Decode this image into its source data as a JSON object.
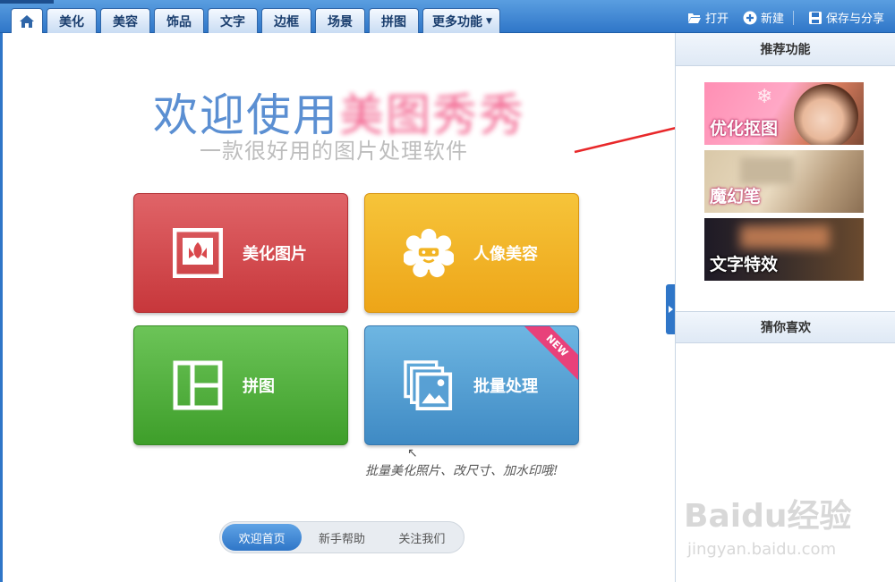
{
  "tabs": [
    {
      "label": "",
      "icon": "home-icon",
      "active": true
    },
    {
      "label": "美化"
    },
    {
      "label": "美容"
    },
    {
      "label": "饰品"
    },
    {
      "label": "文字"
    },
    {
      "label": "边框"
    },
    {
      "label": "场景"
    },
    {
      "label": "拼图"
    }
  ],
  "more_tab": {
    "label": "更多功能"
  },
  "toolbar": {
    "open_label": "打开",
    "new_label": "新建",
    "save_share_label": "保存与分享"
  },
  "welcome": {
    "title_prefix": "欢迎使用",
    "title_brand": "美图秀秀",
    "subtitle": "一款很好用的图片处理软件"
  },
  "cards": [
    {
      "label": "美化图片",
      "icon": "photo-frame-icon",
      "color": "#d9484c"
    },
    {
      "label": "人像美容",
      "icon": "face-flower-icon",
      "color": "#f2b423"
    },
    {
      "label": "拼图",
      "icon": "collage-grid-icon",
      "color": "#55b43f"
    },
    {
      "label": "批量处理",
      "icon": "stacked-photos-icon",
      "color": "#58a0d4",
      "badge": "NEW"
    }
  ],
  "handwritten_note": "批量美化照片、改尺寸、加水印哦!",
  "bottom_nav": [
    {
      "label": "欢迎首页",
      "active": true
    },
    {
      "label": "新手帮助",
      "active": false
    },
    {
      "label": "关注我们",
      "active": false
    }
  ],
  "side": {
    "recommend_title": "推荐功能",
    "features": [
      {
        "label": "优化抠图"
      },
      {
        "label": "魔幻笔"
      },
      {
        "label": "文字特效"
      }
    ],
    "guess_title": "猜你喜欢"
  },
  "watermark": {
    "text": "Baidu经验",
    "url": "jingyan.baidu.com"
  },
  "colors": {
    "topbar": "#2f76c8",
    "accent_red": "#e8282a",
    "brand_pink": "#f04a7c"
  }
}
